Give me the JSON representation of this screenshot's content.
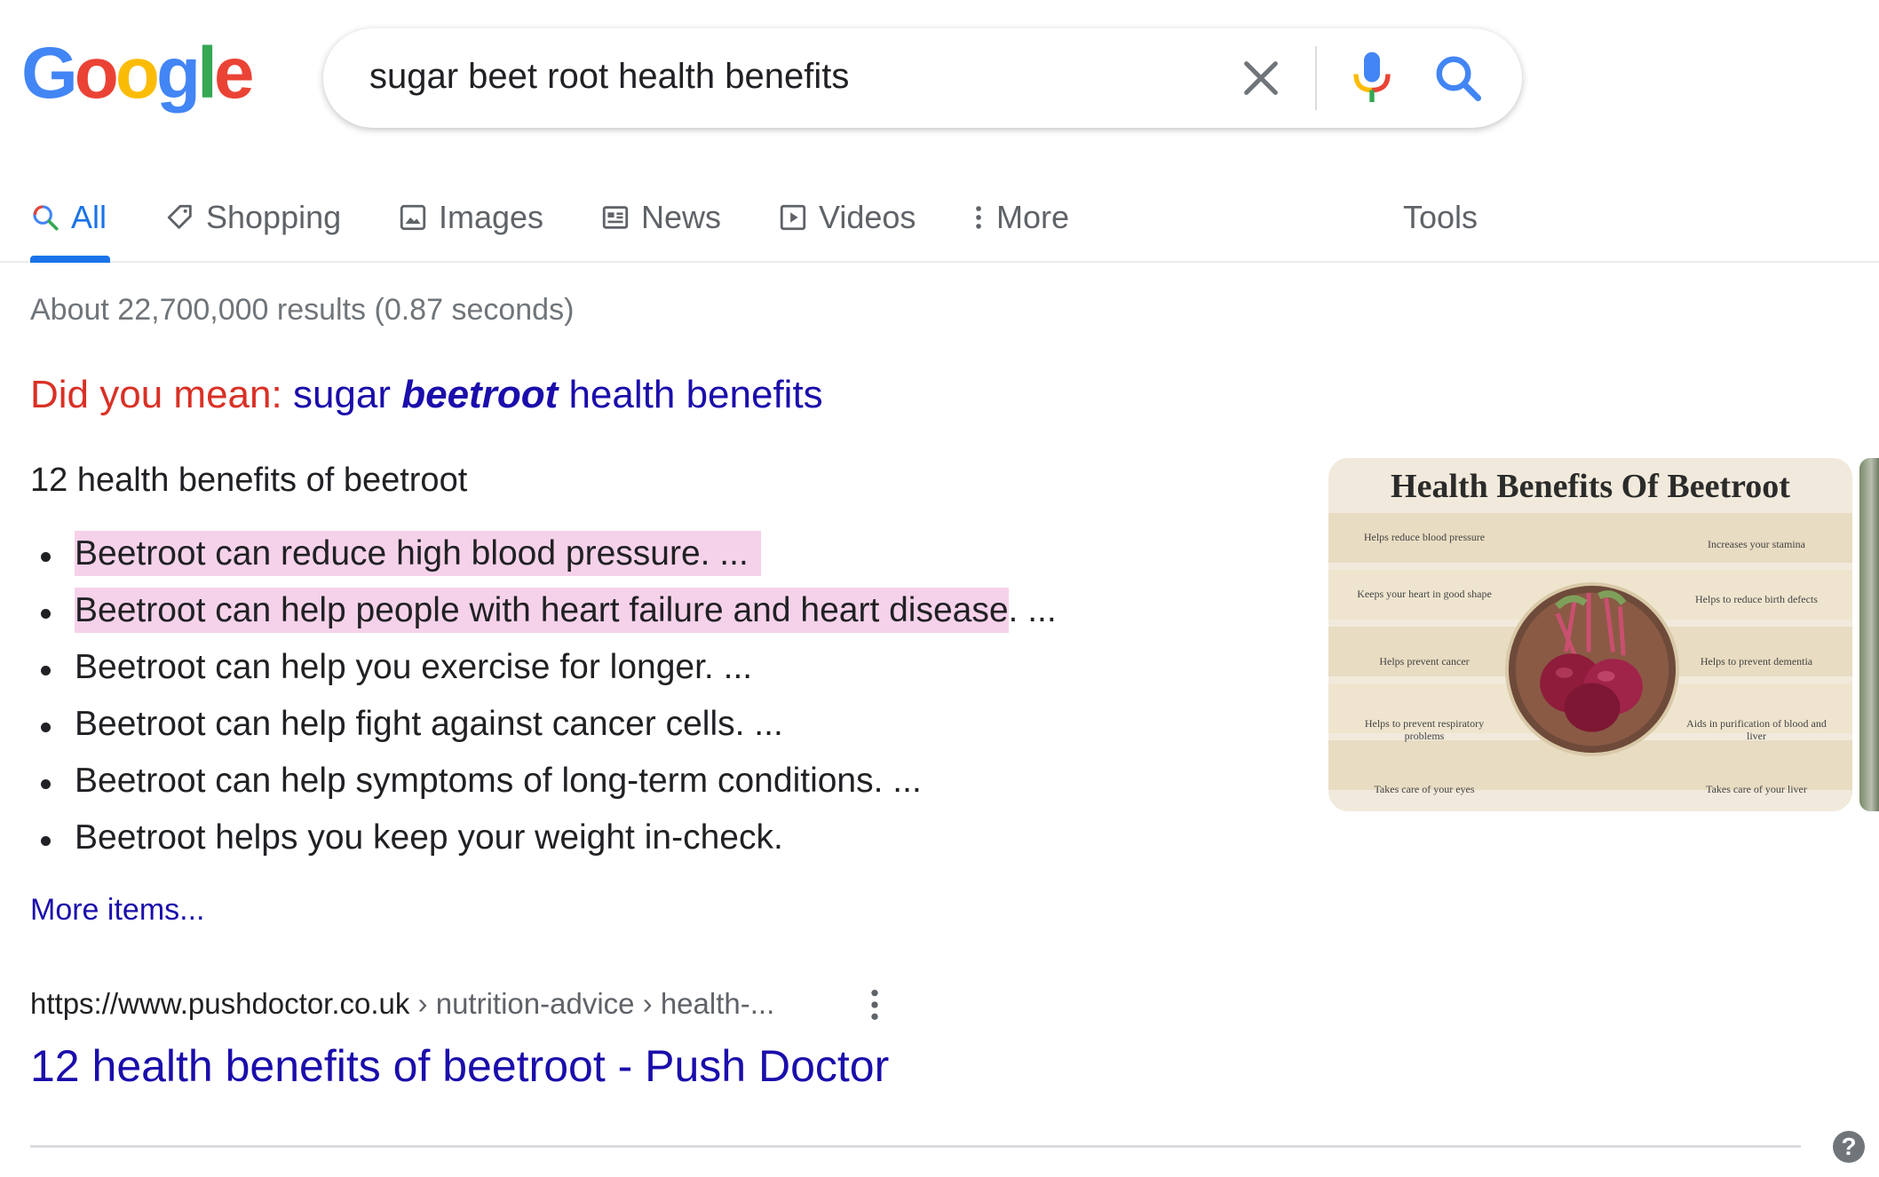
{
  "logo": {
    "letters": [
      "G",
      "o",
      "o",
      "g",
      "l",
      "e"
    ],
    "colors": [
      "#4285F4",
      "#EA4335",
      "#FBBC05",
      "#4285F4",
      "#34A853",
      "#EA4335"
    ]
  },
  "search": {
    "query": "sugar beet root health benefits",
    "icons": [
      "clear-icon",
      "microphone-icon",
      "search-icon"
    ]
  },
  "tabs": [
    {
      "label": "All",
      "icon": "search-icon",
      "active": true
    },
    {
      "label": "Shopping",
      "icon": "tag-icon"
    },
    {
      "label": "Images",
      "icon": "image-icon"
    },
    {
      "label": "News",
      "icon": "newspaper-icon"
    },
    {
      "label": "Videos",
      "icon": "play-icon"
    },
    {
      "label": "More",
      "icon": "kebab-icon"
    },
    {
      "label": "Tools"
    }
  ],
  "stats": "About 22,700,000 results (0.87 seconds)",
  "did_you_mean": {
    "prefix": "Did you mean:",
    "before": "sugar ",
    "corrected": "beetroot",
    "after": " health benefits"
  },
  "snippet": {
    "heading": "12 health benefits of beetroot",
    "items": [
      {
        "text": "Beetroot can reduce high blood pressure. ...",
        "highlight": "Beetroot can reduce high blood pressure. ...",
        "rest": ""
      },
      {
        "text": "Beetroot can help people with heart failure and heart disease. ...",
        "highlight": "Beetroot can help people with heart failure and heart disease",
        "rest": ". ..."
      },
      {
        "text": "Beetroot can help you exercise for longer. ..."
      },
      {
        "text": "Beetroot can help fight against cancer cells. ..."
      },
      {
        "text": "Beetroot can help symptoms of long-term conditions. ..."
      },
      {
        "text": "Beetroot helps you keep your weight in-check."
      }
    ],
    "more_items": "More items..."
  },
  "result": {
    "domain": "https://www.pushdoctor.co.uk",
    "path": " › nutrition-advice › health-...",
    "title": "12 health benefits of beetroot - Push Doctor"
  },
  "infographic": {
    "title": "Health Benefits Of Beetroot",
    "left_labels": [
      "Helps reduce blood pressure",
      "Keeps your heart in good shape",
      "Helps prevent cancer",
      "Helps to prevent respiratory problems",
      "Takes care of your eyes"
    ],
    "right_labels": [
      "Increases your stamina",
      "Helps to reduce birth defects",
      "Helps to prevent dementia",
      "Aids in purification of blood and liver",
      "Takes care of your liver"
    ]
  },
  "help_label": "?"
}
